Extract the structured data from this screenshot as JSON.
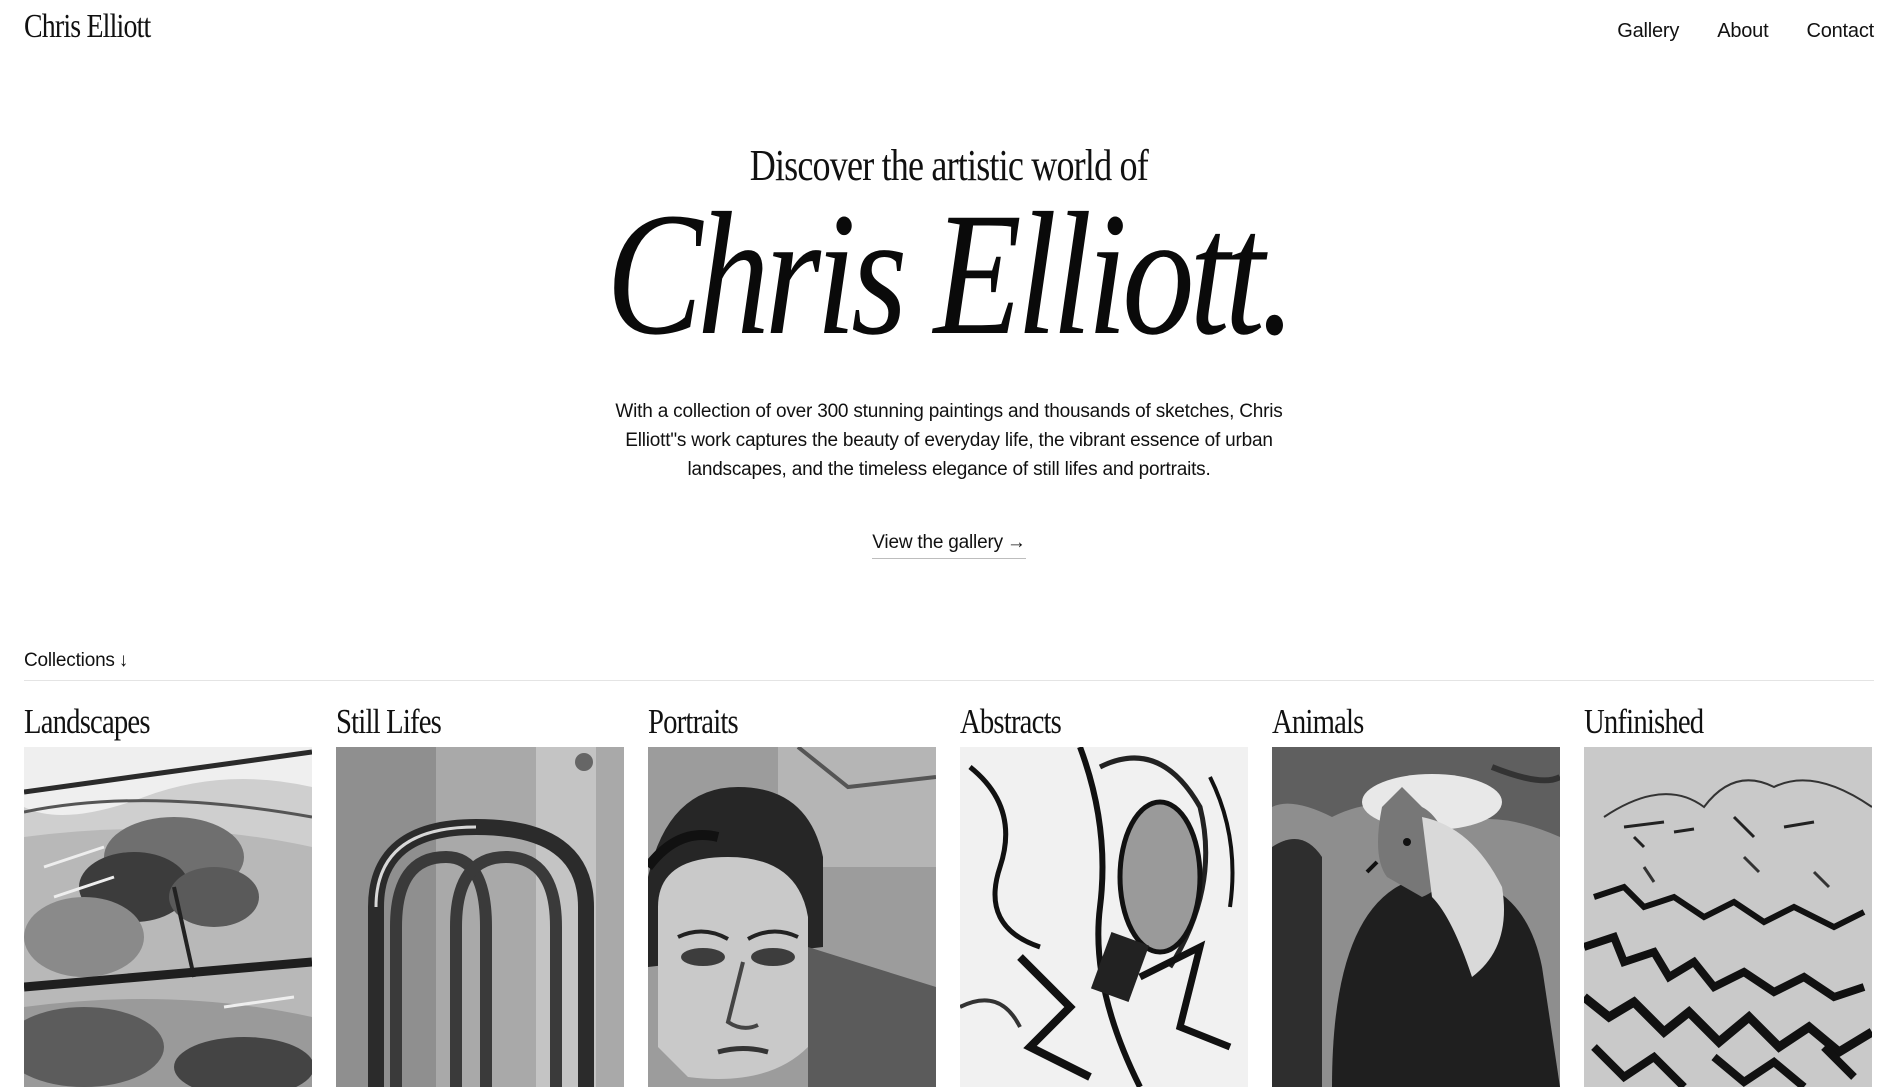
{
  "header": {
    "logo": "Chris Elliott",
    "nav": [
      "Gallery",
      "About",
      "Contact"
    ]
  },
  "hero": {
    "kicker": "Discover the artistic world of",
    "name": "Chris Elliott.",
    "description": "With a collection of over 300 stunning paintings and thousands of sketches, Chris Elliott\"s work captures the beauty of everyday life, the vibrant essence of urban landscapes, and the timeless elegance of still lifes and portraits.",
    "cta_label": "View the gallery",
    "cta_arrow": "→"
  },
  "collections": {
    "label": "Collections",
    "arrow": "↓",
    "items": [
      {
        "title": "Landscapes",
        "icon": "landscape-painting-image"
      },
      {
        "title": "Still Lifes",
        "icon": "chair-painting-image"
      },
      {
        "title": "Portraits",
        "icon": "portrait-painting-image"
      },
      {
        "title": "Abstracts",
        "icon": "abstract-sketch-image"
      },
      {
        "title": "Animals",
        "icon": "dog-painting-image"
      },
      {
        "title": "Unfinished",
        "icon": "ink-sketch-image"
      }
    ]
  },
  "colors": {
    "background": "#ffffff",
    "text": "#111111",
    "divider": "#e4e4e4"
  }
}
